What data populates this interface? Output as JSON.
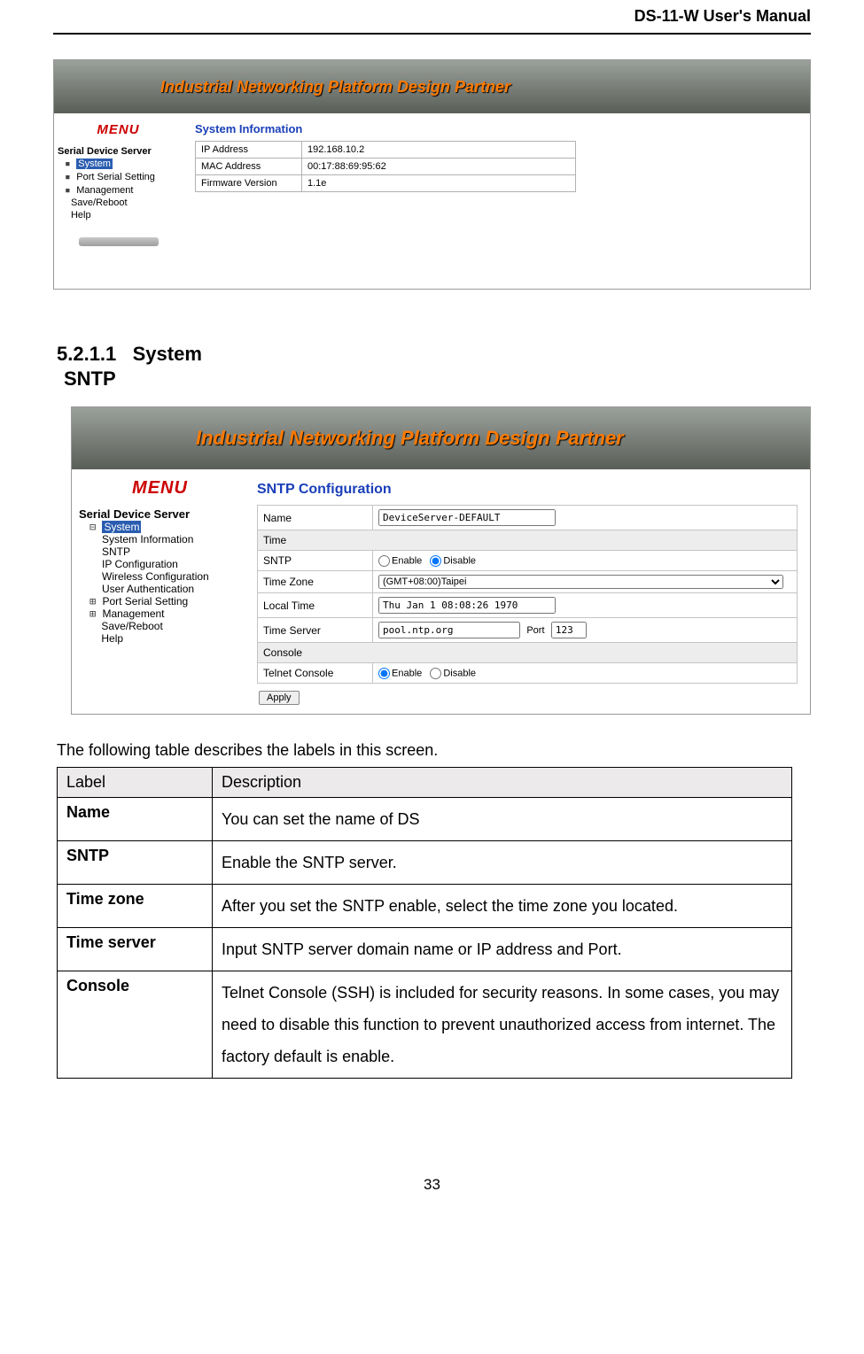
{
  "header": {
    "title": "DS-11-W User's Manual"
  },
  "shot1": {
    "banner": "Industrial  Networking Platform Design Partner",
    "menu_label": "MENU",
    "menu_heading": "Serial Device Server",
    "menu": {
      "system": "System",
      "port": "Port Serial Setting",
      "mgmt": "Management",
      "save": "Save/Reboot",
      "help": "Help"
    },
    "content_title": "System Information",
    "rows": [
      {
        "label": "IP Address",
        "value": "192.168.10.2"
      },
      {
        "label": "MAC Address",
        "value": "00:17:88:69:95:62"
      },
      {
        "label": "Firmware Version",
        "value": "1.1e"
      }
    ]
  },
  "section": {
    "num": "5.2.1.1",
    "title": "System",
    "sub": "SNTP"
  },
  "shot2": {
    "banner": "Industrial  Networking Platform Design Partner",
    "menu_label": "MENU",
    "menu_heading": "Serial Device Server",
    "menu": {
      "system": "System",
      "sys_info": "System Information",
      "sntp": "SNTP",
      "ipconf": "IP Configuration",
      "wireless": "Wireless Configuration",
      "userauth": "User Authentication",
      "port": "Port Serial Setting",
      "mgmt": "Management",
      "save": "Save/Reboot",
      "help": "Help"
    },
    "content_title": "SNTP Configuration",
    "name_label": "Name",
    "name_value": "DeviceServer-DEFAULT",
    "time_section": "Time",
    "sntp_label": "SNTP",
    "enable": "Enable",
    "disable": "Disable",
    "tz_label": "Time Zone",
    "tz_value": "(GMT+08:00)Taipei",
    "local_label": "Local Time",
    "local_value": "Thu Jan 1 08:08:26 1970",
    "server_label": "Time Server",
    "server_value": "pool.ntp.org",
    "port_label": "Port",
    "port_value": "123",
    "console_section": "Console",
    "telnet_label": "Telnet Console",
    "apply": "Apply"
  },
  "desc": {
    "intro": "The following table describes the labels in this screen.",
    "head_label": "Label",
    "head_desc": "Description",
    "rows": [
      {
        "label": "Name",
        "desc": "You can set the name of DS"
      },
      {
        "label": "SNTP",
        "desc": "Enable the SNTP server."
      },
      {
        "label": "Time zone",
        "desc": "After you set the SNTP enable, select the time zone you located."
      },
      {
        "label": "Time server",
        "desc": "Input SNTP server domain name or IP address and Port."
      },
      {
        "label": "Console",
        "desc": "Telnet Console (SSH) is included for security reasons.    In some cases, you may need to disable this function to prevent unauthorized access from internet.    The factory default is enable."
      }
    ]
  },
  "page_num": "33"
}
